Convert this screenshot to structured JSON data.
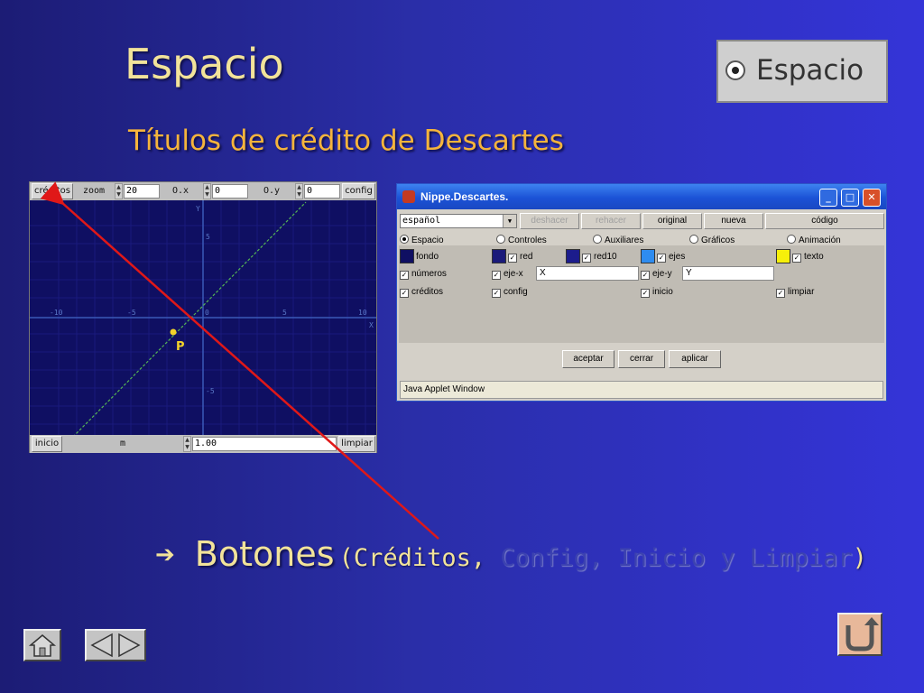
{
  "slide": {
    "title": "Espacio",
    "subtitle": "Títulos de crédito de Descartes",
    "badge_label": "Espacio",
    "bullet": {
      "main": "Botones",
      "open_paren": "(",
      "item1": "Créditos,",
      "rest": " Config, Inicio y Limpiar",
      "close_paren": ")"
    }
  },
  "applet": {
    "top_bar": {
      "creditos": "créditos",
      "zoom_label": "zoom",
      "zoom_value": "20",
      "ox_label": "O.x",
      "ox_value": "0",
      "oy_label": "O.y",
      "oy_value": "0",
      "config": "config"
    },
    "bottom_bar": {
      "inicio": "inicio",
      "m_label": "m",
      "m_value": "1.00",
      "limpiar": "limpiar"
    },
    "axes": {
      "x_name": "X",
      "y_name": "Y",
      "x_ticks": [
        "-10",
        "-5",
        "0",
        "5",
        "10"
      ],
      "y_ticks": [
        "5",
        "-5"
      ]
    },
    "point_label": "P"
  },
  "dialog": {
    "title": "Nippe.Descartes.",
    "language": "español",
    "toolbar": {
      "deshacer": "deshacer",
      "rehacer": "rehacer",
      "original": "original",
      "nueva": "nueva",
      "codigo": "código"
    },
    "tabs": {
      "espacio": "Espacio",
      "controles": "Controles",
      "auxiliares": "Auxiliares",
      "graficos": "Gráficos",
      "animacion": "Animación"
    },
    "row1": {
      "fondo": "fondo",
      "red": "red",
      "red10": "red10",
      "ejes": "ejes",
      "texto": "texto"
    },
    "row2": {
      "numeros": "números",
      "ejex": "eje-x",
      "ejex_value": "X",
      "ejey": "eje-y",
      "ejey_value": "Y"
    },
    "row3": {
      "creditos": "créditos",
      "config": "config",
      "inicio": "inicio",
      "limpiar": "limpiar"
    },
    "buttons": {
      "aceptar": "aceptar",
      "cerrar": "cerrar",
      "aplicar": "aplicar"
    },
    "status": "Java Applet Window",
    "swatch_colors": {
      "fondo": "#0f0f62",
      "red": "#1a1a7a",
      "red10": "#1c1c8c",
      "ejes": "#2e8cf0",
      "texto": "#f6f00a"
    }
  },
  "colors": {
    "title": "#f2e39a",
    "subtitle": "#f5b43c",
    "graph_line": "#55b455",
    "pointer_line": "#e01818",
    "point": "#f2d22a"
  },
  "icons": [
    "home-icon",
    "prev-icon",
    "next-icon",
    "return-icon",
    "check-icon",
    "arrow-bullet-icon"
  ]
}
